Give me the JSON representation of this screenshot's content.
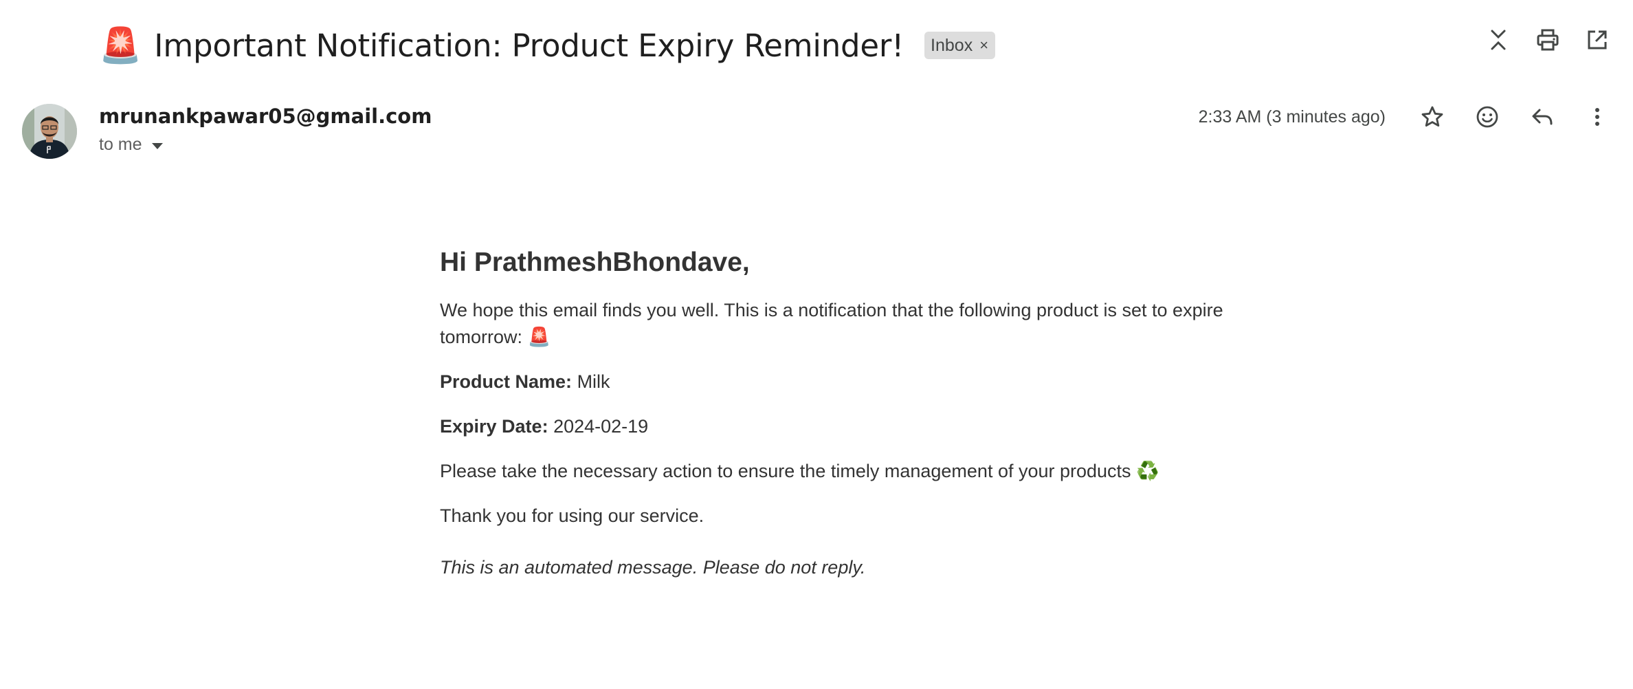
{
  "subject": {
    "emoji": "🚨",
    "title": "Important Notification: Product Expiry Reminder!",
    "label_chip": "Inbox",
    "label_chip_close": "×"
  },
  "toolbar": {
    "icons": [
      "collapse-icon",
      "print-icon",
      "open-new-window-icon"
    ]
  },
  "message_header": {
    "sender_email": "mrunankpawar05@gmail.com",
    "recipient_text": "to me",
    "timestamp": "2:33 AM (3 minutes ago)",
    "actions": [
      "star-icon",
      "emoji-react-icon",
      "reply-icon",
      "more-vert-icon"
    ]
  },
  "body": {
    "greeting": "Hi PrathmeshBhondave,",
    "intro_text": "We hope this email finds you well. This is a notification that the following product is set to expire tomorrow:",
    "intro_emoji": "🚨",
    "product_label": "Product Name:",
    "product_value": "Milk",
    "expiry_label": "Expiry Date:",
    "expiry_value": "2024-02-19",
    "action_text": "Please take the necessary action to ensure the timely management of your products",
    "action_emoji": "♻️",
    "thanks_text": "Thank you for using our service.",
    "automated_note": "This is an automated message. Please do not reply."
  },
  "colors": {
    "chip_bg": "#dddddd",
    "text_primary": "#1f1f1f",
    "text_body": "#333333",
    "siren": "#e0312b",
    "recycle": "#2e8b3a"
  }
}
